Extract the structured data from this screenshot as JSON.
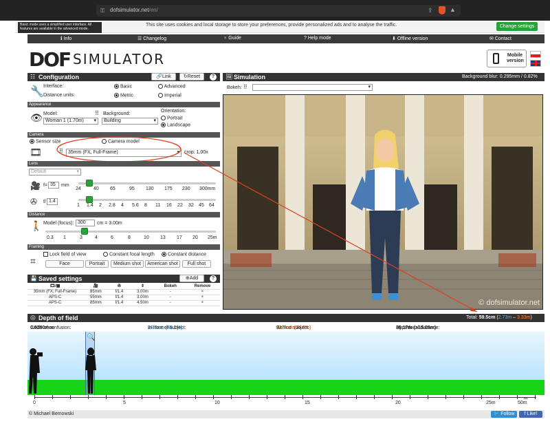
{
  "browser": {
    "url_host": "dofsimulator.net",
    "url_path": "/en/"
  },
  "tooltip": "Basic mode uses a simplified user interface. All features are available in the advanced mode.",
  "cookie": {
    "text": "This site uses cookies and local storage to store your preferences, provide personalized ads and to analyse the traffic.",
    "button": "Change settings"
  },
  "nav": [
    "Info",
    "Changelog",
    "Guide",
    "Help mode",
    "Offline version",
    "Contact"
  ],
  "logo": {
    "dof": "DOF",
    "sim": "SIMULATOR"
  },
  "mobile_button": "Mobile version",
  "config": {
    "title": "Configuration",
    "link_btn": "Link",
    "reset_btn": "Reset",
    "interface_label": "Interface:",
    "interface_opts": [
      "Basic",
      "Advanced"
    ],
    "units_label": "Distance units:",
    "units_opts": [
      "Metric",
      "Imperial"
    ],
    "appearance": "Appearance",
    "model_label": "Model:",
    "model_value": "Woman 1 (1.70m)",
    "bg_label": "Background:",
    "bg_value": "Building",
    "orient_label": "Orientation:",
    "orient_opts": [
      "Portrait",
      "Landscape"
    ],
    "camera": "Camera",
    "sensor_size": "Sensor size",
    "camera_model": "Camera model",
    "sensor_value": "35mm (FX, Full-Frame)",
    "crop": "crop: 1.00x",
    "lens": "Lens",
    "lens_value": "Default",
    "focal_prefix": "f=",
    "focal_value": "35",
    "focal_unit": "mm",
    "focal_ticks": [
      "24",
      "40",
      "65",
      "95",
      "130",
      "175",
      "230",
      "300mm"
    ],
    "aperture_prefix": "f/",
    "aperture_value": "1.4",
    "aperture_ticks": [
      "1",
      "1.4",
      "2",
      "2.8",
      "4",
      "5.6",
      "8",
      "11",
      "16",
      "22",
      "32",
      "45",
      "64"
    ],
    "distance": "Distance",
    "focus_label": "Model (focus):",
    "focus_value": "300",
    "focus_unit": "cm = 3.00m",
    "distance_ticks": [
      "0.3",
      "1",
      "3",
      "4",
      "6",
      "8",
      "10",
      "13",
      "17",
      "20",
      "25m"
    ],
    "framing": "Framing",
    "lock_fov": "Lock field of view",
    "const_focal": "Constant focal length",
    "const_dist": "Constant distance",
    "framing_btns": [
      "Face",
      "Portrait",
      "Medium shot",
      "American shot",
      "Full shot"
    ]
  },
  "saved": {
    "title": "Saved settings",
    "add_btn": "Add",
    "cols": [
      "",
      "",
      "",
      "",
      "Bokeh",
      "Remove"
    ],
    "rows": [
      [
        "35mm (FX, Full-Frame)",
        "85mm",
        "f/1.4",
        "3.00m",
        "-",
        "×"
      ],
      [
        "APS-C",
        "55mm",
        "f/1.4",
        "3.00m",
        "-",
        "×"
      ],
      [
        "APS-C",
        "85mm",
        "f/1.4",
        "4.50m",
        "-",
        "×"
      ]
    ]
  },
  "simulation": {
    "title": "Simulation",
    "bg_blur": "Background blur: 0.295mm / 0.82%",
    "bokeh_label": "Bokeh:",
    "watermark": "© dofsimulator.net",
    "total_prefix": "Total: ",
    "total_value": "59.5cm",
    "total_front": "2.73m",
    "total_sep": " – ",
    "total_back": "3.33m"
  },
  "dof": {
    "title": "Depth of field",
    "coc_label": "Circle of confusion: ",
    "coc_value": "0.0290mm",
    "front_label": "In front of subject: ",
    "front_value": "26.8cm (45.1%)",
    "behind_label": "Behind subject: ",
    "behind_value": "32.7cm (54.9%)",
    "hyper_label": "Hyperfocal distance: ",
    "hyper_value": "30.17m (>15.09m)",
    "axis": [
      "0",
      "5",
      "10",
      "15",
      "20",
      "25m",
      "50m"
    ],
    "infinity": "∞"
  },
  "footer": {
    "copyright": "© Michael Bemowski",
    "follow": "Follow",
    "like": "Like!"
  },
  "colors": {
    "green": "#2aa23a",
    "blue": "#2f8fd6",
    "orange": "#e0662a",
    "sky": "#bfe6ff",
    "grass": "#1bd11b",
    "arrow": "#e04020"
  }
}
